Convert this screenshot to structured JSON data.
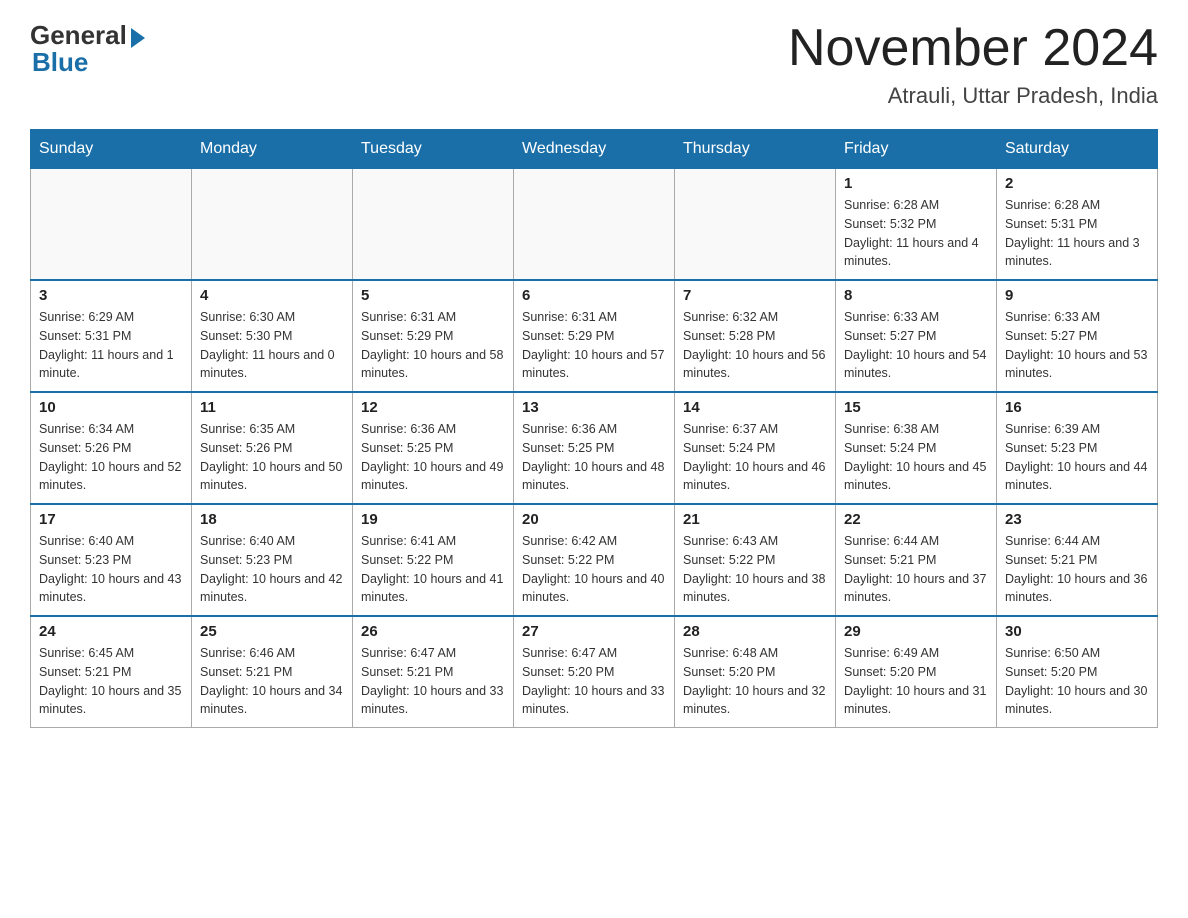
{
  "logo": {
    "general_text": "General",
    "blue_text": "Blue"
  },
  "header": {
    "month_year": "November 2024",
    "location": "Atrauli, Uttar Pradesh, India"
  },
  "days_of_week": [
    "Sunday",
    "Monday",
    "Tuesday",
    "Wednesday",
    "Thursday",
    "Friday",
    "Saturday"
  ],
  "weeks": [
    [
      {
        "day": "",
        "info": ""
      },
      {
        "day": "",
        "info": ""
      },
      {
        "day": "",
        "info": ""
      },
      {
        "day": "",
        "info": ""
      },
      {
        "day": "",
        "info": ""
      },
      {
        "day": "1",
        "info": "Sunrise: 6:28 AM\nSunset: 5:32 PM\nDaylight: 11 hours and 4 minutes."
      },
      {
        "day": "2",
        "info": "Sunrise: 6:28 AM\nSunset: 5:31 PM\nDaylight: 11 hours and 3 minutes."
      }
    ],
    [
      {
        "day": "3",
        "info": "Sunrise: 6:29 AM\nSunset: 5:31 PM\nDaylight: 11 hours and 1 minute."
      },
      {
        "day": "4",
        "info": "Sunrise: 6:30 AM\nSunset: 5:30 PM\nDaylight: 11 hours and 0 minutes."
      },
      {
        "day": "5",
        "info": "Sunrise: 6:31 AM\nSunset: 5:29 PM\nDaylight: 10 hours and 58 minutes."
      },
      {
        "day": "6",
        "info": "Sunrise: 6:31 AM\nSunset: 5:29 PM\nDaylight: 10 hours and 57 minutes."
      },
      {
        "day": "7",
        "info": "Sunrise: 6:32 AM\nSunset: 5:28 PM\nDaylight: 10 hours and 56 minutes."
      },
      {
        "day": "8",
        "info": "Sunrise: 6:33 AM\nSunset: 5:27 PM\nDaylight: 10 hours and 54 minutes."
      },
      {
        "day": "9",
        "info": "Sunrise: 6:33 AM\nSunset: 5:27 PM\nDaylight: 10 hours and 53 minutes."
      }
    ],
    [
      {
        "day": "10",
        "info": "Sunrise: 6:34 AM\nSunset: 5:26 PM\nDaylight: 10 hours and 52 minutes."
      },
      {
        "day": "11",
        "info": "Sunrise: 6:35 AM\nSunset: 5:26 PM\nDaylight: 10 hours and 50 minutes."
      },
      {
        "day": "12",
        "info": "Sunrise: 6:36 AM\nSunset: 5:25 PM\nDaylight: 10 hours and 49 minutes."
      },
      {
        "day": "13",
        "info": "Sunrise: 6:36 AM\nSunset: 5:25 PM\nDaylight: 10 hours and 48 minutes."
      },
      {
        "day": "14",
        "info": "Sunrise: 6:37 AM\nSunset: 5:24 PM\nDaylight: 10 hours and 46 minutes."
      },
      {
        "day": "15",
        "info": "Sunrise: 6:38 AM\nSunset: 5:24 PM\nDaylight: 10 hours and 45 minutes."
      },
      {
        "day": "16",
        "info": "Sunrise: 6:39 AM\nSunset: 5:23 PM\nDaylight: 10 hours and 44 minutes."
      }
    ],
    [
      {
        "day": "17",
        "info": "Sunrise: 6:40 AM\nSunset: 5:23 PM\nDaylight: 10 hours and 43 minutes."
      },
      {
        "day": "18",
        "info": "Sunrise: 6:40 AM\nSunset: 5:23 PM\nDaylight: 10 hours and 42 minutes."
      },
      {
        "day": "19",
        "info": "Sunrise: 6:41 AM\nSunset: 5:22 PM\nDaylight: 10 hours and 41 minutes."
      },
      {
        "day": "20",
        "info": "Sunrise: 6:42 AM\nSunset: 5:22 PM\nDaylight: 10 hours and 40 minutes."
      },
      {
        "day": "21",
        "info": "Sunrise: 6:43 AM\nSunset: 5:22 PM\nDaylight: 10 hours and 38 minutes."
      },
      {
        "day": "22",
        "info": "Sunrise: 6:44 AM\nSunset: 5:21 PM\nDaylight: 10 hours and 37 minutes."
      },
      {
        "day": "23",
        "info": "Sunrise: 6:44 AM\nSunset: 5:21 PM\nDaylight: 10 hours and 36 minutes."
      }
    ],
    [
      {
        "day": "24",
        "info": "Sunrise: 6:45 AM\nSunset: 5:21 PM\nDaylight: 10 hours and 35 minutes."
      },
      {
        "day": "25",
        "info": "Sunrise: 6:46 AM\nSunset: 5:21 PM\nDaylight: 10 hours and 34 minutes."
      },
      {
        "day": "26",
        "info": "Sunrise: 6:47 AM\nSunset: 5:21 PM\nDaylight: 10 hours and 33 minutes."
      },
      {
        "day": "27",
        "info": "Sunrise: 6:47 AM\nSunset: 5:20 PM\nDaylight: 10 hours and 33 minutes."
      },
      {
        "day": "28",
        "info": "Sunrise: 6:48 AM\nSunset: 5:20 PM\nDaylight: 10 hours and 32 minutes."
      },
      {
        "day": "29",
        "info": "Sunrise: 6:49 AM\nSunset: 5:20 PM\nDaylight: 10 hours and 31 minutes."
      },
      {
        "day": "30",
        "info": "Sunrise: 6:50 AM\nSunset: 5:20 PM\nDaylight: 10 hours and 30 minutes."
      }
    ]
  ]
}
